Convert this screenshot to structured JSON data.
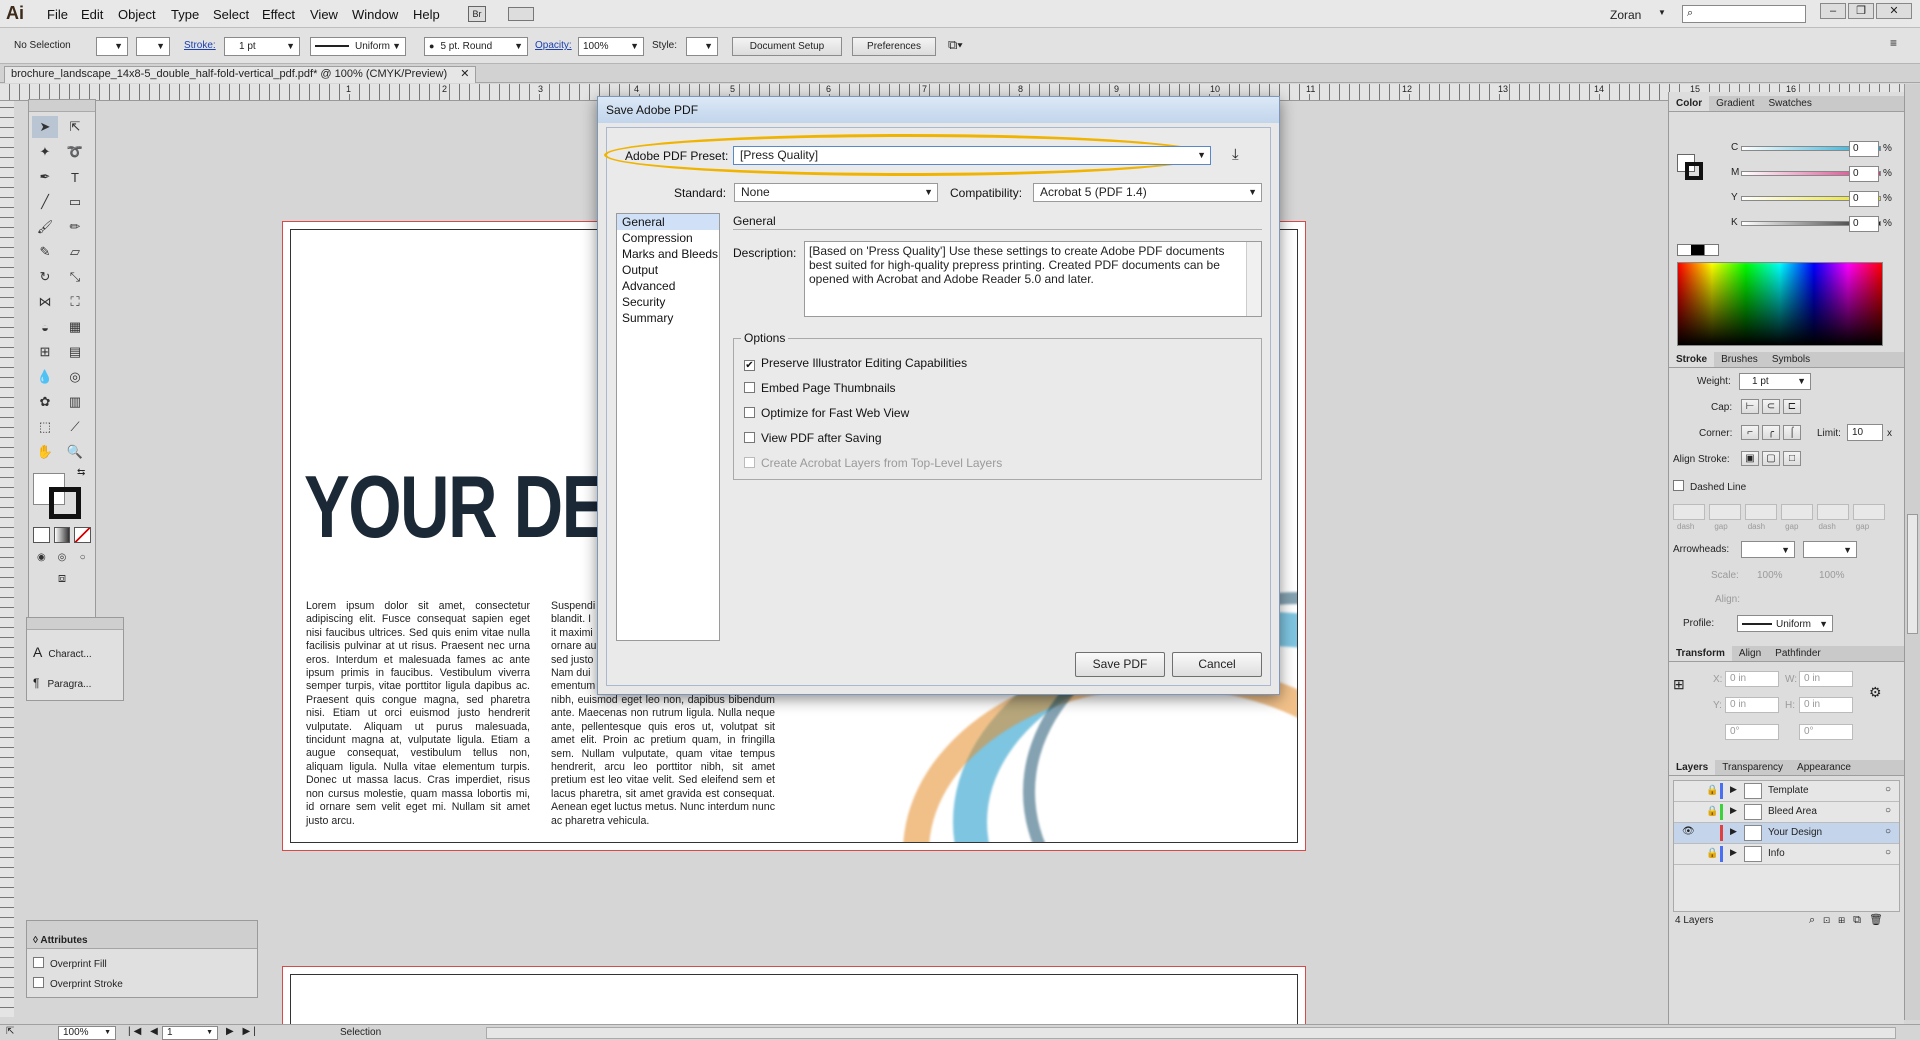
{
  "app": {
    "logo": "Ai",
    "user": "Zoran"
  },
  "menu": [
    "File",
    "Edit",
    "Object",
    "Type",
    "Select",
    "Effect",
    "View",
    "Window",
    "Help"
  ],
  "menu_extra": {
    "bridge": "Br"
  },
  "control": {
    "selection": "No Selection",
    "stroke_label": "Stroke:",
    "stroke_weight": "1 pt",
    "profile": "Uniform",
    "brush": "5 pt. Round",
    "opacity_label": "Opacity:",
    "opacity": "100%",
    "style_label": "Style:",
    "doc_setup": "Document Setup",
    "preferences": "Preferences"
  },
  "document": {
    "tab": "brochure_landscape_14x8-5_double_half-fold-vertical_pdf.pdf* @ 100% (CMYK/Preview)"
  },
  "ruler_numbers": [
    "1",
    "2",
    "3",
    "4",
    "5",
    "6",
    "7",
    "8",
    "9",
    "10",
    "11",
    "12",
    "13",
    "14",
    "15",
    "16"
  ],
  "artboard": {
    "headline": "YOUR DESIG",
    "col1": "Lorem ipsum dolor sit amet, consectetur adipiscing elit. Fusce consequat sapien eget nisi faucibus ultrices. Sed quis enim vitae nulla facilisis pulvinar at ut risus. Praesent nec urna eros. Interdum et malesuada fames ac ante ipsum primis in faucibus. Vestibulum viverra semper turpis, vitae porttitor ligula dapibus ac. Praesent quis congue magna, sed pharetra nisi. Etiam ut orci euismod justo hendrerit vulputate. Aliquam ut purus malesuada, tincidunt magna at, vulputate ligula. Etiam a augue consequat, vestibulum tellus non, aliquam ligula. Nulla vitae elementum turpis. Donec ut massa lacus. Cras imperdiet, risus non cursus molestie, quam massa lobortis mi, id ornare sem velit eget mi. Nullam sit amet justo arcu.",
    "col2_top": [
      "Suspendi",
      "blandit. I",
      "it maximi",
      "ornare au",
      "sed justo",
      "Nam dui",
      "ementum"
    ],
    "col2": "nibh, euismod eget leo non, dapibus bibendum ante. Maecenas non rutrum ligula. Nulla neque ante, pellentesque quis eros ut, volutpat sit amet elit. Proin ac pretium quam, in fringilla sem. Nullam vulputate, quam vitae tempus hendrerit, arcu leo porttitor nibh, sit amet pretium est leo vitae velit. Sed eleifend sem et lacus pharetra, sit amet gravida est consequat. Aenean eget luctus metus. Nunc interdum nunc ac pharetra vehicula."
  },
  "tools_panel": {
    "char": "Charact...",
    "para": "Paragra..."
  },
  "attributes_panel": {
    "title": "Attributes",
    "overprint_fill": "Overprint Fill",
    "overprint_stroke": "Overprint Stroke"
  },
  "dialog": {
    "title": "Save Adobe PDF",
    "preset_label": "Adobe PDF Preset:",
    "preset_value": "[Press Quality]",
    "standard_label": "Standard:",
    "standard_value": "None",
    "compat_label": "Compatibility:",
    "compat_value": "Acrobat 5 (PDF 1.4)",
    "nav": [
      "General",
      "Compression",
      "Marks and Bleeds",
      "Output",
      "Advanced",
      "Security",
      "Summary"
    ],
    "section_title": "General",
    "description_label": "Description:",
    "description": "[Based on 'Press Quality'] Use these settings to create Adobe PDF documents best suited for high-quality prepress printing.  Created PDF documents can be opened with Acrobat and Adobe Reader 5.0 and later.",
    "options_label": "Options",
    "options": [
      {
        "label": "Preserve Illustrator Editing Capabilities",
        "checked": true,
        "enabled": true
      },
      {
        "label": "Embed Page Thumbnails",
        "checked": false,
        "enabled": true
      },
      {
        "label": "Optimize for Fast Web View",
        "checked": false,
        "enabled": true
      },
      {
        "label": "View PDF after Saving",
        "checked": false,
        "enabled": true
      },
      {
        "label": "Create Acrobat Layers from Top-Level Layers",
        "checked": false,
        "enabled": false
      }
    ],
    "save_btn": "Save PDF",
    "cancel_btn": "Cancel",
    "highlight_color": "#f0b400"
  },
  "color_panel": {
    "tabs": [
      "Color",
      "Gradient",
      "Swatches"
    ],
    "channels": [
      {
        "name": "C",
        "value": "0",
        "unit": "%",
        "color": "#12a7d8"
      },
      {
        "name": "M",
        "value": "0",
        "unit": "%",
        "color": "#d7337f"
      },
      {
        "name": "Y",
        "value": "0",
        "unit": "%",
        "color": "#e7e018"
      },
      {
        "name": "K",
        "value": "0",
        "unit": "%",
        "color": "#222222"
      }
    ]
  },
  "stroke_panel": {
    "tabs": [
      "Stroke",
      "Brushes",
      "Symbols"
    ],
    "weight_label": "Weight:",
    "weight": "1 pt",
    "cap_label": "Cap:",
    "corner_label": "Corner:",
    "limit_label": "Limit:",
    "limit": "10",
    "limit_unit": "x",
    "align_label": "Align Stroke:",
    "dashed_label": "Dashed Line",
    "dash_labels": [
      "dash",
      "gap",
      "dash",
      "gap",
      "dash",
      "gap"
    ],
    "arrowheads_label": "Arrowheads:",
    "scale_label": "Scale:",
    "scale1": "100%",
    "scale2": "100%",
    "align_label2": "Align:",
    "profile_label": "Profile:",
    "profile": "Uniform"
  },
  "transform_panel": {
    "tabs": [
      "Transform",
      "Align",
      "Pathfinder"
    ],
    "x_label": "X:",
    "x": "0 in",
    "w_label": "W:",
    "w": "0 in",
    "y_label": "Y:",
    "y": "0 in",
    "h_label": "H:",
    "h": "0 in",
    "angle1": "0°",
    "angle2": "0°"
  },
  "layers_panel": {
    "tabs": [
      "Layers",
      "Transparency",
      "Appearance"
    ],
    "layers": [
      {
        "name": "Template",
        "color": "#4a6ff0",
        "locked": true,
        "visible": false,
        "selected": false
      },
      {
        "name": "Bleed Area",
        "color": "#3bd23b",
        "locked": true,
        "visible": false,
        "selected": false
      },
      {
        "name": "Your Design",
        "color": "#e04040",
        "locked": false,
        "visible": true,
        "selected": true
      },
      {
        "name": "Info",
        "color": "#4a6ff0",
        "locked": true,
        "visible": false,
        "selected": false
      }
    ],
    "count": "4 Layers"
  },
  "status": {
    "zoom": "100%",
    "page": "1",
    "tool": "Selection"
  }
}
